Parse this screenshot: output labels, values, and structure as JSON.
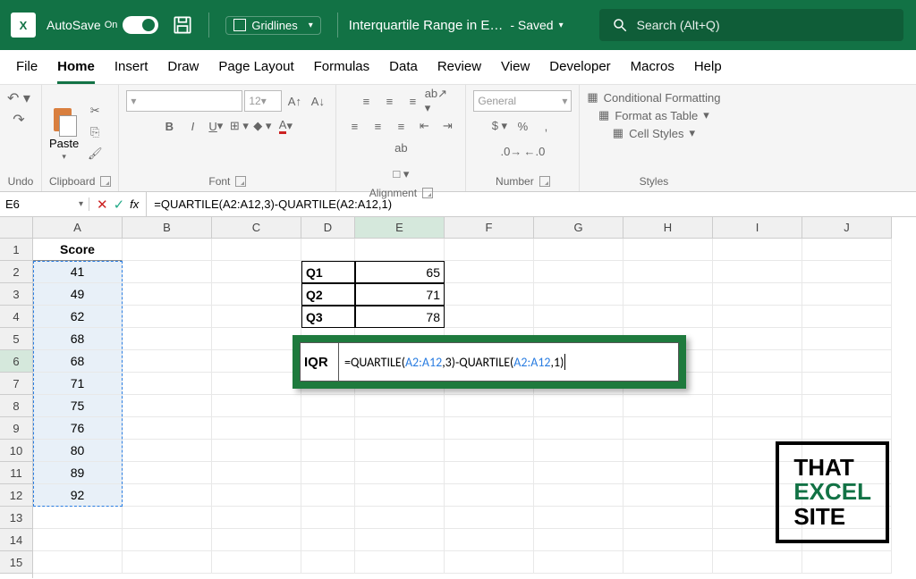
{
  "titlebar": {
    "autosave_label": "AutoSave",
    "autosave_state": "On",
    "gridlines_label": "Gridlines",
    "filename": "Interquartile Range in E…",
    "saved": "- Saved",
    "search_placeholder": "Search (Alt+Q)"
  },
  "tabs": [
    "File",
    "Home",
    "Insert",
    "Draw",
    "Page Layout",
    "Formulas",
    "Data",
    "Review",
    "View",
    "Developer",
    "Macros",
    "Help"
  ],
  "active_tab": "Home",
  "ribbon": {
    "undo_label": "Undo",
    "clipboard_label": "Clipboard",
    "paste_label": "Paste",
    "font_label": "Font",
    "font_size": "12",
    "alignment_label": "Alignment",
    "wrap_label": "ab",
    "number_label": "Number",
    "number_format": "General",
    "styles_label": "Styles",
    "cond_fmt": "Conditional Formatting",
    "fmt_table": "Format as Table",
    "cell_styles": "Cell Styles"
  },
  "namebox": "E6",
  "formula": "=QUARTILE(A2:A12,3)-QUARTILE(A2:A12,1)",
  "columns": [
    "A",
    "B",
    "C",
    "D",
    "E",
    "F",
    "G",
    "H",
    "I",
    "J"
  ],
  "rows": [
    "1",
    "2",
    "3",
    "4",
    "5",
    "6",
    "7",
    "8",
    "9",
    "10",
    "11",
    "12",
    "13",
    "14",
    "15"
  ],
  "score_header": "Score",
  "scores": [
    41,
    49,
    62,
    68,
    68,
    71,
    75,
    76,
    80,
    89,
    92
  ],
  "q_table": [
    {
      "label": "Q1",
      "value": 65
    },
    {
      "label": "Q2",
      "value": 71
    },
    {
      "label": "Q3",
      "value": 78
    }
  ],
  "iqr": {
    "label": "IQR",
    "formula_prefix1": "=QUARTILE(",
    "ref1": "A2:A12",
    "mid1": ",3)-QUARTILE(",
    "ref2": "A2:A12",
    "suffix": ",1)"
  },
  "logo": {
    "l1": "THAT",
    "l2": "EXCEL",
    "l3": "SITE"
  }
}
